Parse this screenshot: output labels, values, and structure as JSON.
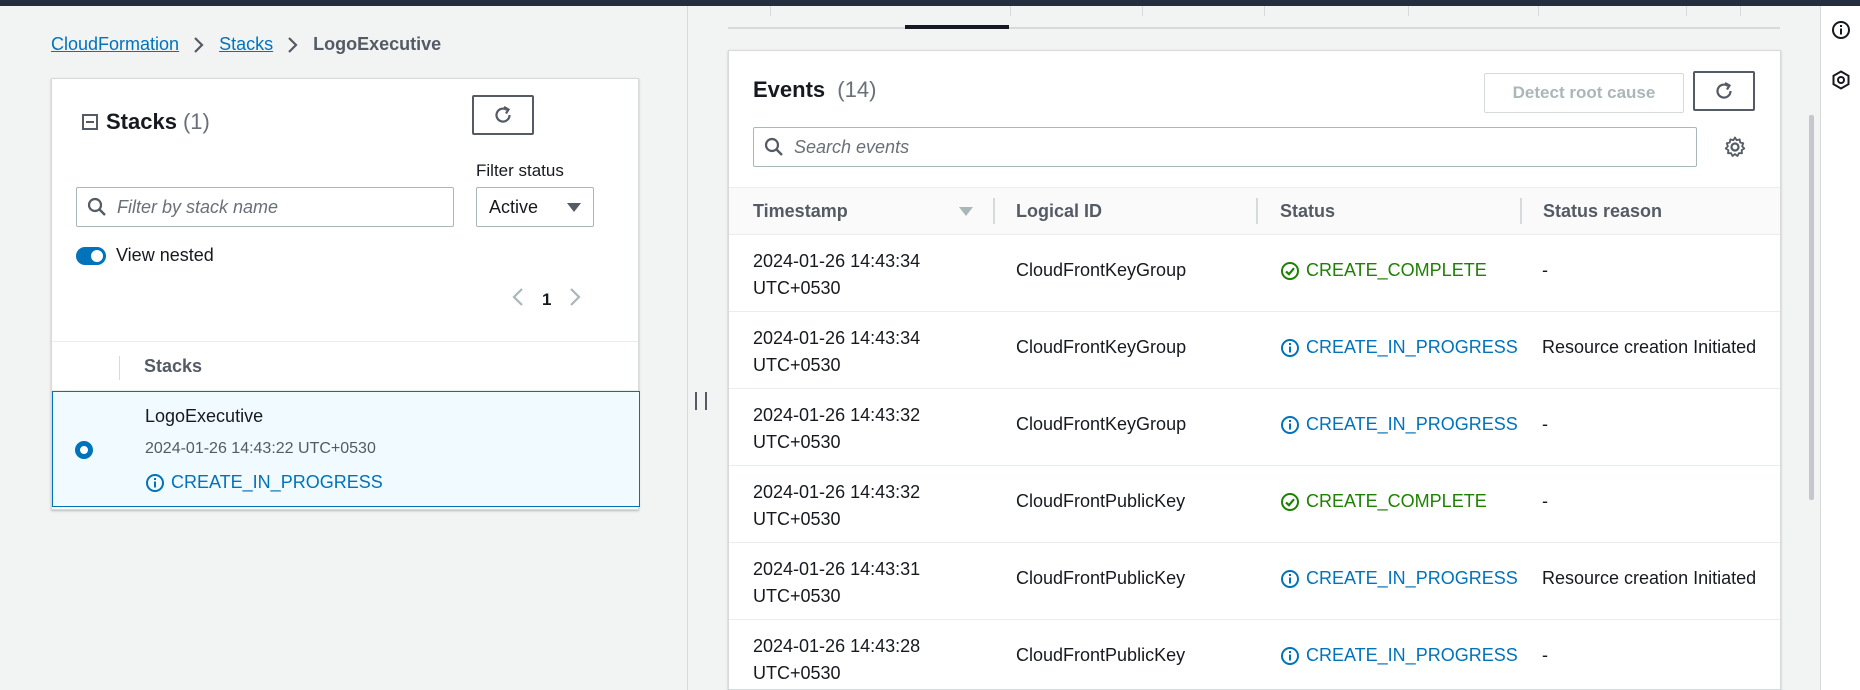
{
  "breadcrumb": {
    "items": [
      "CloudFormation",
      "Stacks"
    ],
    "current": "LogoExecutive"
  },
  "stacks_panel": {
    "title": "Stacks",
    "count": "(1)",
    "filter_status_label": "Filter status",
    "filter_status_value": "Active",
    "search_placeholder": "Filter by stack name",
    "view_nested_label": "View nested",
    "page": "1",
    "column_header": "Stacks",
    "rows": [
      {
        "name": "LogoExecutive",
        "date": "2024-01-26 14:43:22 UTC+0530",
        "status": "CREATE_IN_PROGRESS"
      }
    ]
  },
  "events_panel": {
    "title": "Events",
    "count": "(14)",
    "detect_root_cause_label": "Detect root cause",
    "search_placeholder": "Search events",
    "columns": [
      "Timestamp",
      "Logical ID",
      "Status",
      "Status reason"
    ],
    "rows": [
      {
        "ts1": "2024-01-26 14:43:34",
        "ts2": "UTC+0530",
        "logical_id": "CloudFrontKeyGroup",
        "status": "CREATE_COMPLETE",
        "kind": "ok",
        "reason": "-"
      },
      {
        "ts1": "2024-01-26 14:43:34",
        "ts2": "UTC+0530",
        "logical_id": "CloudFrontKeyGroup",
        "status": "CREATE_IN_PROGRESS",
        "kind": "prog",
        "reason": "Resource creation Initiated"
      },
      {
        "ts1": "2024-01-26 14:43:32",
        "ts2": "UTC+0530",
        "logical_id": "CloudFrontKeyGroup",
        "status": "CREATE_IN_PROGRESS",
        "kind": "prog",
        "reason": "-"
      },
      {
        "ts1": "2024-01-26 14:43:32",
        "ts2": "UTC+0530",
        "logical_id": "CloudFrontPublicKey",
        "status": "CREATE_COMPLETE",
        "kind": "ok",
        "reason": "-"
      },
      {
        "ts1": "2024-01-26 14:43:31",
        "ts2": "UTC+0530",
        "logical_id": "CloudFrontPublicKey",
        "status": "CREATE_IN_PROGRESS",
        "kind": "prog",
        "reason": "Resource creation Initiated"
      },
      {
        "ts1": "2024-01-26 14:43:28",
        "ts2": "UTC+0530",
        "logical_id": "CloudFrontPublicKey",
        "status": "CREATE_IN_PROGRESS",
        "kind": "prog",
        "reason": "-"
      }
    ]
  },
  "icons": {
    "refresh": "refresh-icon",
    "search": "search-icon",
    "info": "info-icon",
    "check": "check-circle-icon",
    "gear": "gear-icon",
    "chevron_right": "chevron-right-icon",
    "chevron_left": "chevron-left-icon"
  },
  "colors": {
    "link": "#0073bb",
    "success": "#1d8102",
    "selected_bg": "#f1faff",
    "topbar": "#232f3e"
  }
}
